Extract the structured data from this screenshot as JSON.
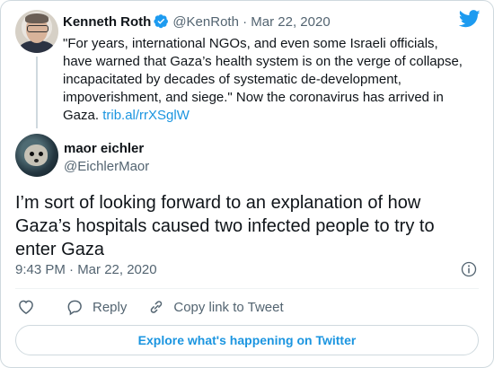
{
  "quoted_tweet": {
    "name": "Kenneth Roth",
    "handle": "@KenRoth",
    "separator": "·",
    "date": "Mar 22, 2020",
    "text": "\"For years, international NGOs, and even some Israeli officials, have warned that Gaza’s health system is on the verge of collapse, incapacitated by decades of systematic de-development, impoverishment, and siege.\" Now the coronavirus has arrived in Gaza.",
    "link": "trib.al/rrXSglW"
  },
  "tweet": {
    "name": "maor eichler",
    "handle": "@EichlerMaor",
    "text": "I’m sort of looking forward to an explanation of how Gaza’s hospitals caused two infected people to try to enter Gaza",
    "timestamp": "9:43 PM · Mar 22, 2020"
  },
  "actions": {
    "reply_label": "Reply",
    "copy_link_label": "Copy link to Tweet"
  },
  "explore_label": "Explore what's happening on Twitter",
  "colors": {
    "accent": "#1b95e0",
    "verified": "#1d9bf0",
    "secondary_text": "#536471",
    "border": "#cfd9de"
  },
  "icons": [
    "twitter-bird-icon",
    "verified-badge-icon",
    "info-icon",
    "heart-icon",
    "reply-icon",
    "link-icon"
  ]
}
